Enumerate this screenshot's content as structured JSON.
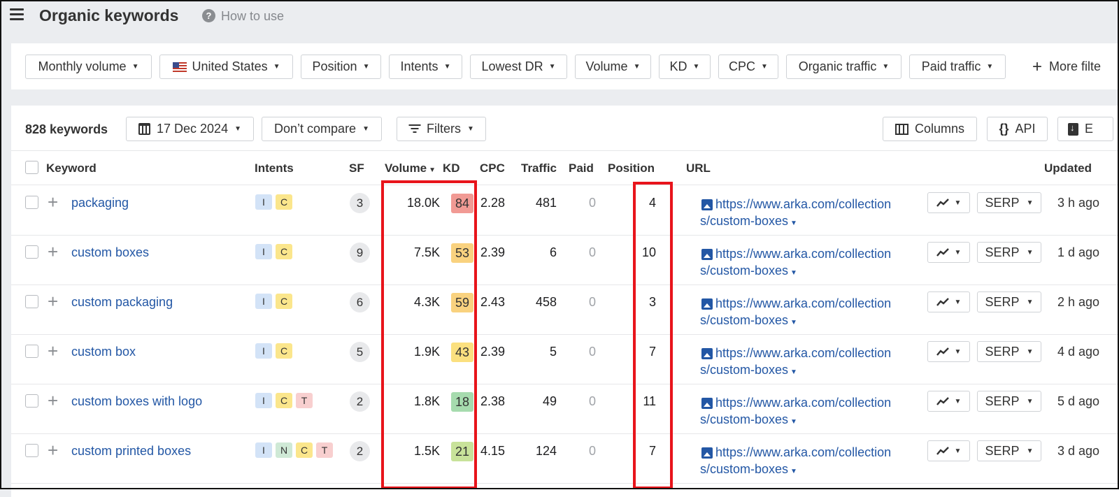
{
  "header": {
    "title": "Organic keywords",
    "help_label": "How to use"
  },
  "filters": [
    "Monthly volume",
    "United States",
    "Position",
    "Intents",
    "Lowest DR",
    "Volume",
    "KD",
    "CPC",
    "Organic traffic",
    "Paid traffic"
  ],
  "more_filters_label": "More filte",
  "toolbar": {
    "count_label": "828 keywords",
    "date_label": "17 Dec 2024",
    "compare_label": "Don’t compare",
    "filters_label": "Filters",
    "columns_label": "Columns",
    "api_label": "API",
    "export_label": "E"
  },
  "columns": {
    "keyword": "Keyword",
    "intents": "Intents",
    "sf": "SF",
    "volume": "Volume",
    "kd": "KD",
    "cpc": "CPC",
    "traffic": "Traffic",
    "paid": "Paid",
    "position": "Position",
    "url": "URL",
    "updated": "Updated"
  },
  "colors": {
    "link": "#2357a5",
    "highlight": "#e8141b",
    "intent_I": "#d3e3f7",
    "intent_C": "#fbe68c",
    "intent_T": "#f8cfcf",
    "intent_N": "#cfe9d6",
    "kd_84": "#f19a94",
    "kd_53": "#f9d27f",
    "kd_59": "#f9d27f",
    "kd_43": "#fbe07f",
    "kd_18": "#a6dbae",
    "kd_21": "#c8e29a"
  },
  "rows": [
    {
      "keyword": "packaging",
      "intents": [
        "I",
        "C"
      ],
      "sf": "3",
      "volume": "18.0K",
      "kd": "84",
      "kd_color": "#f19a94",
      "cpc": "2.28",
      "traffic": "481",
      "paid": "0",
      "position": "4",
      "url_line1": "https://www.arka.com/collection",
      "url_line2": "s/custom-boxes",
      "serp": "SERP",
      "updated": "3 h ago"
    },
    {
      "keyword": "custom boxes",
      "intents": [
        "I",
        "C"
      ],
      "sf": "9",
      "volume": "7.5K",
      "kd": "53",
      "kd_color": "#f9d27f",
      "cpc": "2.39",
      "traffic": "6",
      "paid": "0",
      "position": "10",
      "url_line1": "https://www.arka.com/collection",
      "url_line2": "s/custom-boxes",
      "serp": "SERP",
      "updated": "1 d ago"
    },
    {
      "keyword": "custom packaging",
      "intents": [
        "I",
        "C"
      ],
      "sf": "6",
      "volume": "4.3K",
      "kd": "59",
      "kd_color": "#f9d27f",
      "cpc": "2.43",
      "traffic": "458",
      "paid": "0",
      "position": "3",
      "url_line1": "https://www.arka.com/collection",
      "url_line2": "s/custom-boxes",
      "serp": "SERP",
      "updated": "2 h ago"
    },
    {
      "keyword": "custom box",
      "intents": [
        "I",
        "C"
      ],
      "sf": "5",
      "volume": "1.9K",
      "kd": "43",
      "kd_color": "#fbe07f",
      "cpc": "2.39",
      "traffic": "5",
      "paid": "0",
      "position": "7",
      "url_line1": "https://www.arka.com/collection",
      "url_line2": "s/custom-boxes",
      "serp": "SERP",
      "updated": "4 d ago"
    },
    {
      "keyword": "custom boxes with logo",
      "intents": [
        "I",
        "C",
        "T"
      ],
      "sf": "2",
      "volume": "1.8K",
      "kd": "18",
      "kd_color": "#a6dbae",
      "cpc": "2.38",
      "traffic": "49",
      "paid": "0",
      "position": "11",
      "url_line1": "https://www.arka.com/collection",
      "url_line2": "s/custom-boxes",
      "serp": "SERP",
      "updated": "5 d ago"
    },
    {
      "keyword": "custom printed boxes",
      "intents": [
        "I",
        "N",
        "C",
        "T"
      ],
      "sf": "2",
      "volume": "1.5K",
      "kd": "21",
      "kd_color": "#c8e29a",
      "cpc": "4.15",
      "traffic": "124",
      "paid": "0",
      "position": "7",
      "url_line1": "https://www.arka.com/collection",
      "url_line2": "s/custom-boxes",
      "serp": "SERP",
      "updated": "3 d ago"
    }
  ]
}
